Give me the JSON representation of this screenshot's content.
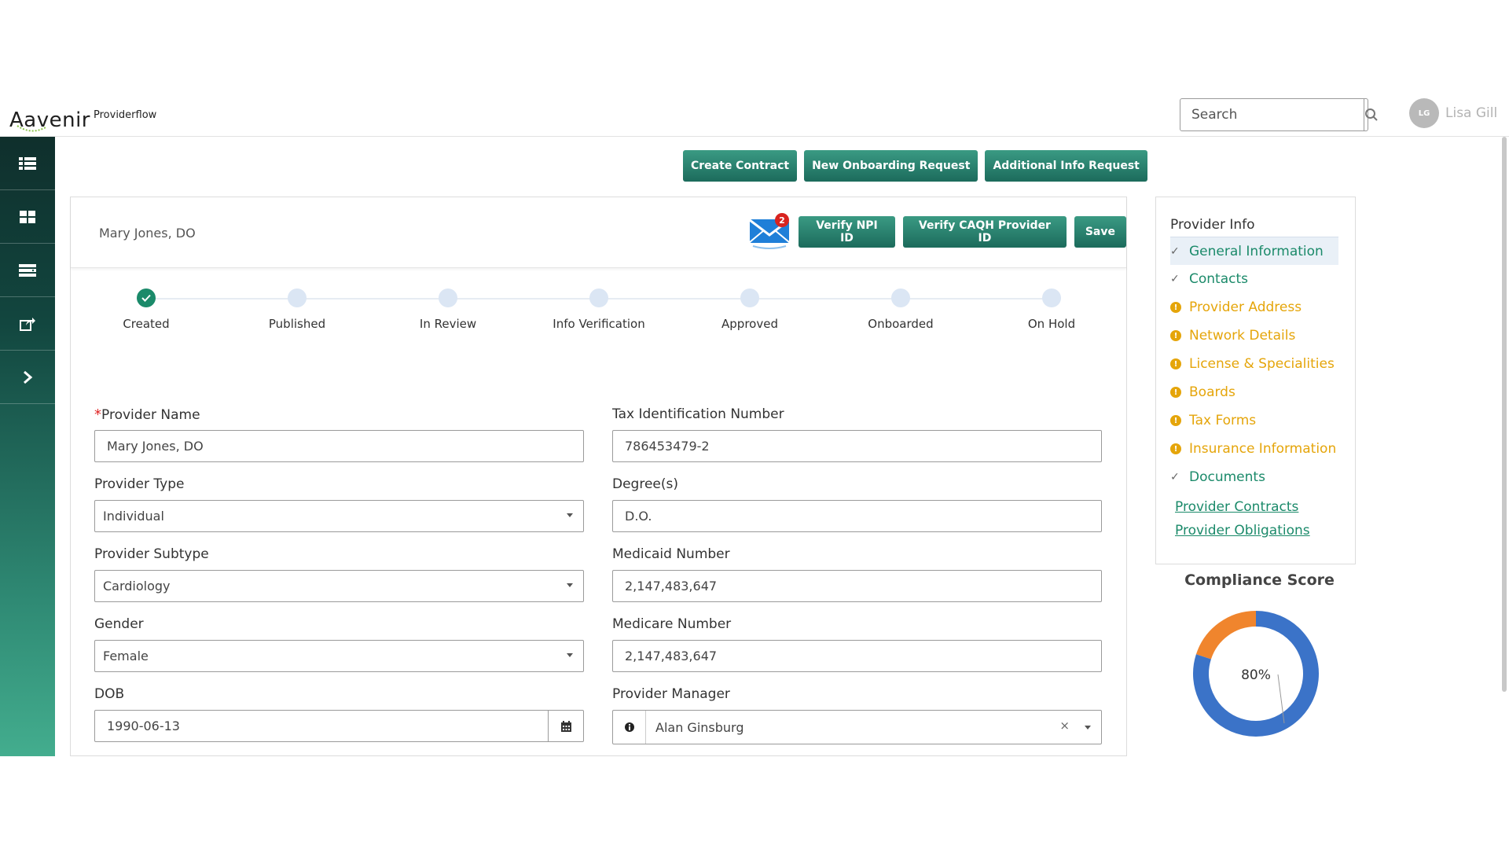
{
  "header": {
    "brand": "Aavenir",
    "app_name": "Providerflow",
    "search_placeholder": "Search",
    "user_initials": "LG",
    "user_name": "Lisa Gill"
  },
  "sidebar": {
    "items": [
      {
        "icon": "list-icon"
      },
      {
        "icon": "grid-icon"
      },
      {
        "icon": "stack-icon"
      },
      {
        "icon": "share-icon"
      },
      {
        "icon": "chevron-right-icon"
      }
    ]
  },
  "actions": {
    "create_contract": "Create Contract",
    "new_onboarding": "New Onboarding Request",
    "additional_info": "Additional Info Request"
  },
  "card": {
    "title": "Mary Jones, DO",
    "mail_badge": "2",
    "verify_npi": "Verify NPI ID",
    "verify_caqh": "Verify CAQH Provider ID",
    "save": "Save"
  },
  "stepper": {
    "steps": [
      "Created",
      "Published",
      "In Review",
      "Info Verification",
      "Approved",
      "Onboarded",
      "On Hold"
    ],
    "completed": 1
  },
  "form": {
    "required_mark": "*",
    "provider_name": {
      "label": "Provider Name",
      "value": "Mary Jones, DO"
    },
    "tax_id": {
      "label": "Tax Identification Number",
      "value": "786453479-2"
    },
    "provider_type": {
      "label": "Provider Type",
      "value": "Individual"
    },
    "degrees": {
      "label": "Degree(s)",
      "value": "D.O."
    },
    "provider_subtype": {
      "label": "Provider Subtype",
      "value": "Cardiology"
    },
    "medicaid": {
      "label": "Medicaid Number",
      "value": "2,147,483,647"
    },
    "gender": {
      "label": "Gender",
      "value": "Female"
    },
    "medicare": {
      "label": "Medicare Number",
      "value": "2,147,483,647"
    },
    "dob": {
      "label": "DOB",
      "value": "1990-06-13"
    },
    "provider_manager": {
      "label": "Provider Manager",
      "value": "Alan Ginsburg",
      "clear": "×"
    }
  },
  "panel": {
    "title": "Provider Info",
    "items": [
      {
        "label": "General Information",
        "status": "ok",
        "active": true
      },
      {
        "label": "Contacts",
        "status": "ok"
      },
      {
        "label": "Provider Address",
        "status": "warn"
      },
      {
        "label": "Network Details",
        "status": "warn"
      },
      {
        "label": "License & Specialities",
        "status": "warn"
      },
      {
        "label": "Boards",
        "status": "warn"
      },
      {
        "label": "Tax Forms",
        "status": "warn"
      },
      {
        "label": "Insurance Information",
        "status": "warn"
      },
      {
        "label": "Documents",
        "status": "ok"
      }
    ],
    "links": [
      "Provider Contracts",
      "Provider Obligations"
    ]
  },
  "compliance": {
    "title": "Compliance Score",
    "value_label": "80%",
    "percent": 80,
    "colors": {
      "score": "#3b73c8",
      "remaining": "#f0852d"
    }
  },
  "colors": {
    "accent": "#1b8a6a",
    "warning": "#e5a50a",
    "badge": "#d8231f"
  }
}
